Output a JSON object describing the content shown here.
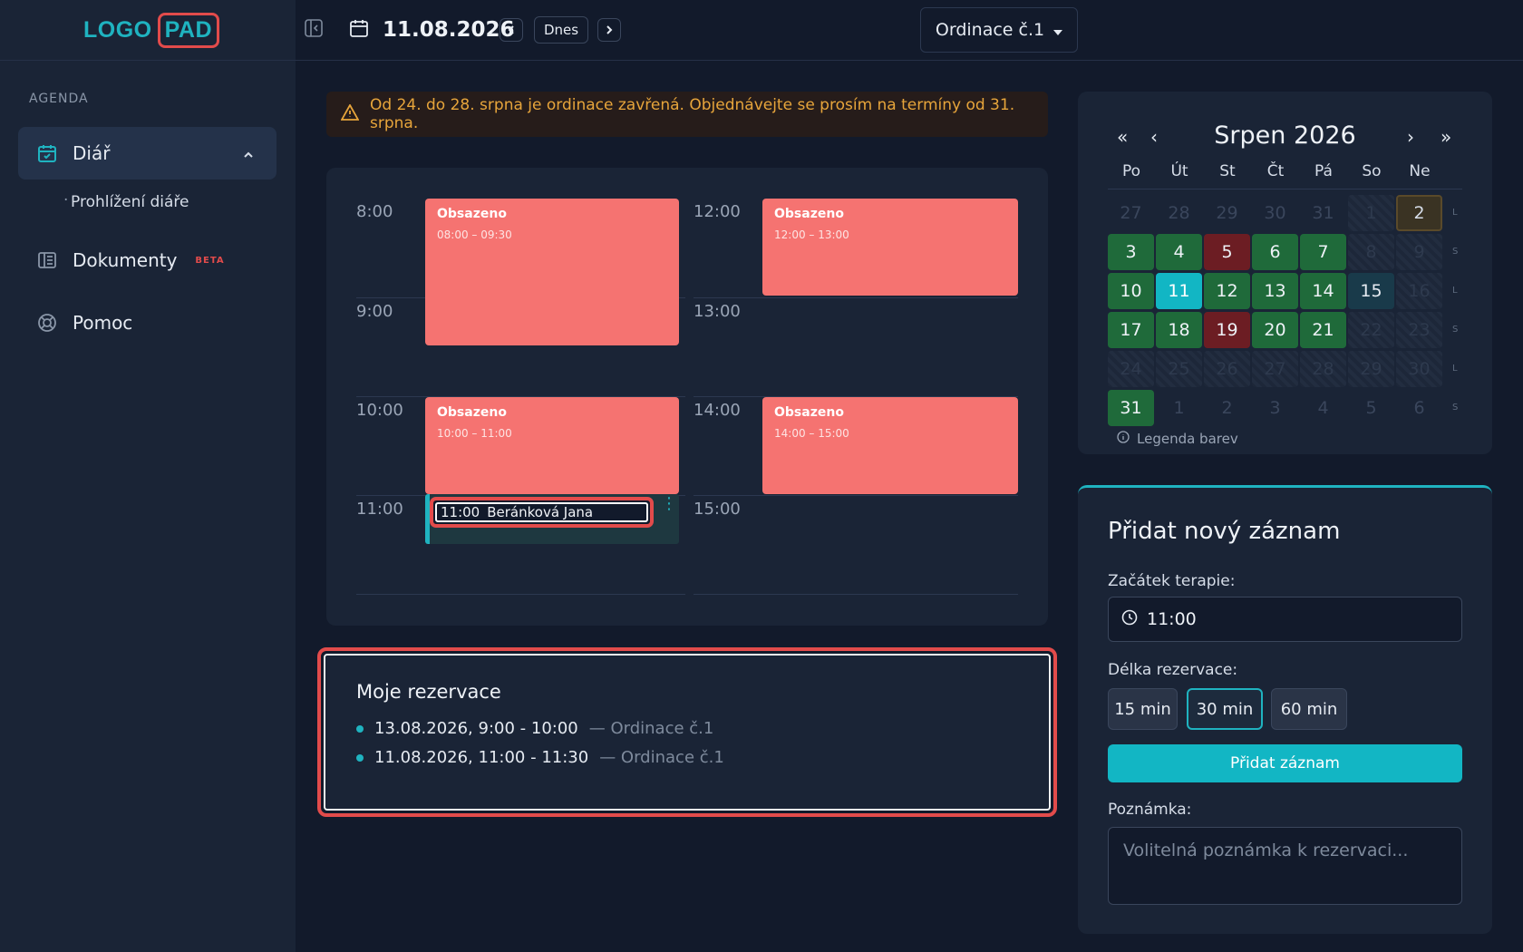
{
  "logo": {
    "part1": "LOGO",
    "part2": "PAD"
  },
  "sidebar": {
    "section_label": "AGENDA",
    "items": [
      {
        "label": "Diář",
        "icon": "calendar-check-icon",
        "active": true
      },
      {
        "label": "Dokumenty",
        "badge": "BETA",
        "icon": "book-icon"
      },
      {
        "label": "Pomoc",
        "icon": "lifebuoy-icon"
      }
    ],
    "subitem": "Prohlížení diáře"
  },
  "topbar": {
    "date": "11.08.2026",
    "today_label": "Dnes",
    "office_select": "Ordinace č.1"
  },
  "alert": {
    "text": "Od 24. do 28. srpna je ordinace zavřená. Objednávejte se prosím na termíny od 31. srpna.",
    "color": "#e7a53b"
  },
  "schedule": {
    "times_left": [
      "8:00",
      "9:00",
      "10:00",
      "11:00"
    ],
    "times_right": [
      "12:00",
      "13:00",
      "14:00",
      "15:00"
    ],
    "booked": [
      {
        "title": "Obsazeno",
        "range": "08:00 – 09:30"
      },
      {
        "title": "Obsazeno",
        "range": "12:00 – 13:00"
      },
      {
        "title": "Obsazeno",
        "range": "10:00 – 11:00"
      },
      {
        "title": "Obsazeno",
        "range": "14:00 – 15:00"
      }
    ],
    "mine": {
      "time": "11:00",
      "name": "Beránková Jana"
    }
  },
  "my_reservations": {
    "title": "Moje rezervace",
    "items": [
      {
        "when": "13.08.2026, 9:00 - 10:00",
        "where": "— Ordinace č.1"
      },
      {
        "when": "11.08.2026, 11:00 - 11:30",
        "where": "— Ordinace č.1"
      }
    ]
  },
  "calendar": {
    "title": "Srpen 2026",
    "weekdays": [
      "Po",
      "Út",
      "St",
      "Čt",
      "Pá",
      "So",
      "Ne"
    ],
    "week_letters": [
      "L",
      "S",
      "L",
      "S",
      "L",
      "S"
    ],
    "legend": "Legenda barev",
    "rows": [
      [
        [
          "27",
          "mute"
        ],
        [
          "28",
          "mute"
        ],
        [
          "29",
          "mute"
        ],
        [
          "30",
          "mute"
        ],
        [
          "31",
          "mute"
        ],
        [
          "1",
          "stripe"
        ],
        [
          "2",
          "sel"
        ]
      ],
      [
        [
          "3",
          "green"
        ],
        [
          "4",
          "green"
        ],
        [
          "5",
          "red"
        ],
        [
          "6",
          "green"
        ],
        [
          "7",
          "green"
        ],
        [
          "8",
          "stripe"
        ],
        [
          "9",
          "stripe"
        ]
      ],
      [
        [
          "10",
          "green"
        ],
        [
          "11",
          "today"
        ],
        [
          "12",
          "green"
        ],
        [
          "13",
          "green"
        ],
        [
          "14",
          "green"
        ],
        [
          "15",
          "teal"
        ],
        [
          "16",
          "stripe"
        ]
      ],
      [
        [
          "17",
          "green"
        ],
        [
          "18",
          "green"
        ],
        [
          "19",
          "red"
        ],
        [
          "20",
          "green"
        ],
        [
          "21",
          "green"
        ],
        [
          "22",
          "stripe"
        ],
        [
          "23",
          "stripe"
        ]
      ],
      [
        [
          "24",
          "stripe"
        ],
        [
          "25",
          "stripe"
        ],
        [
          "26",
          "stripe"
        ],
        [
          "27",
          "stripe"
        ],
        [
          "28",
          "stripe"
        ],
        [
          "29",
          "stripe"
        ],
        [
          "30",
          "stripe"
        ]
      ],
      [
        [
          "31",
          "green"
        ],
        [
          "1",
          "mute"
        ],
        [
          "2",
          "mute"
        ],
        [
          "3",
          "mute"
        ],
        [
          "4",
          "mute"
        ],
        [
          "5",
          "mute"
        ],
        [
          "6",
          "mute"
        ]
      ]
    ]
  },
  "form": {
    "title": "Přidat nový záznam",
    "start_label": "Začátek terapie:",
    "start_value": "11:00",
    "duration_label": "Délka rezervace:",
    "durations": [
      "15 min",
      "30 min",
      "60 min"
    ],
    "selected_duration": "30 min",
    "submit_label": "Přidat záznam",
    "note_label": "Poznámka:",
    "note_placeholder": "Volitelná poznámka k rezervaci..."
  },
  "colors": {
    "accent": "#1fb3c0",
    "booked": "#f57371",
    "danger": "#e24b4b",
    "available": "#1f6a3a"
  }
}
